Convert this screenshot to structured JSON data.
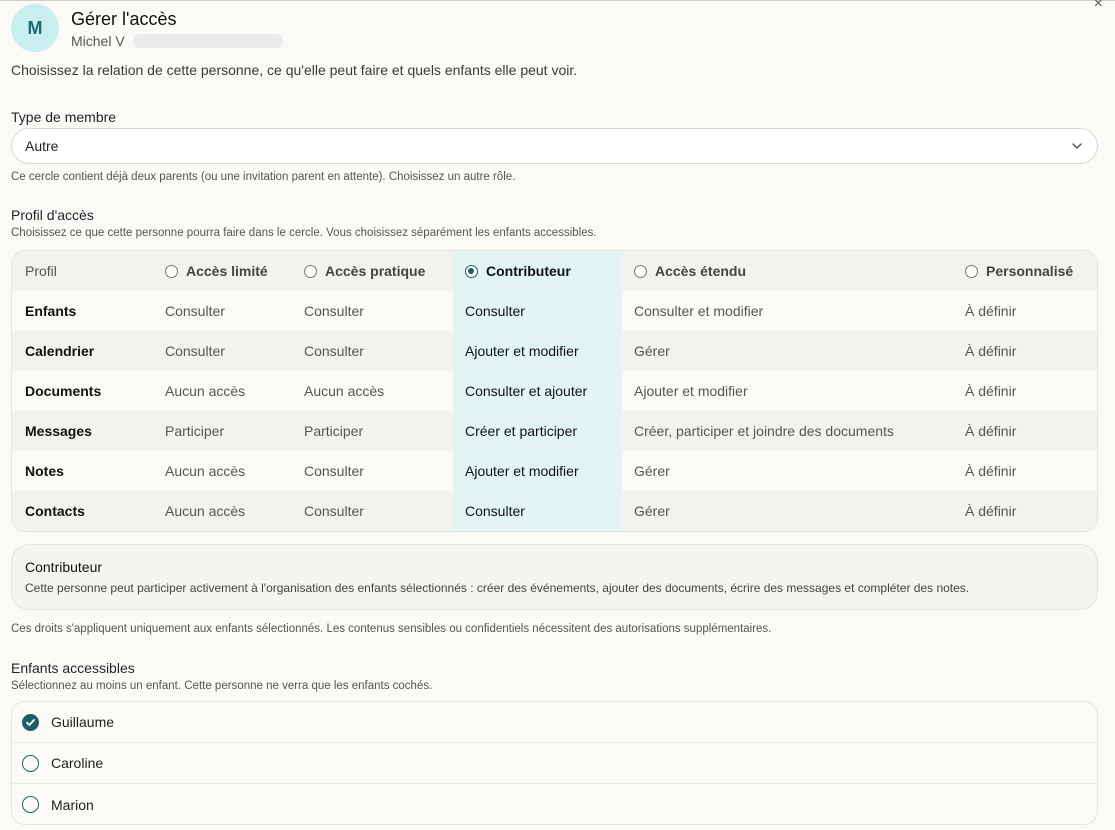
{
  "header": {
    "avatar_initial": "M",
    "title": "Gérer l'accès",
    "user_name": "Michel V",
    "close_glyph": "×"
  },
  "intro": "Choisissez la relation de cette personne, ce qu'elle peut faire et quels enfants elle peut voir.",
  "member_type": {
    "label": "Type de membre",
    "selected": "Autre",
    "hint": "Ce cercle contient déjà deux parents (ou une invitation parent en attente). Choisissez un autre rôle."
  },
  "access_profile": {
    "label": "Profil d'accès",
    "hint": "Choisissez ce que cette personne pourra faire dans le cercle. Vous choisissez séparément les enfants accessibles.",
    "corner_label": "Profil",
    "columns": [
      {
        "label": "Accès limité",
        "selected": false
      },
      {
        "label": "Accès pratique",
        "selected": false
      },
      {
        "label": "Contributeur",
        "selected": true
      },
      {
        "label": "Accès étendu",
        "selected": false
      },
      {
        "label": "Personnalisé",
        "selected": false
      }
    ],
    "rows": [
      {
        "name": "Enfants",
        "values": [
          "Consulter",
          "Consulter",
          "Consulter",
          "Consulter et modifier",
          "À définir"
        ]
      },
      {
        "name": "Calendrier",
        "values": [
          "Consulter",
          "Consulter",
          "Ajouter et modifier",
          "Gérer",
          "À définir"
        ]
      },
      {
        "name": "Documents",
        "values": [
          "Aucun accès",
          "Aucun accès",
          "Consulter et ajouter",
          "Ajouter et modifier",
          "À définir"
        ]
      },
      {
        "name": "Messages",
        "values": [
          "Participer",
          "Participer",
          "Créer et participer",
          "Créer, participer et joindre des documents",
          "À définir"
        ]
      },
      {
        "name": "Notes",
        "values": [
          "Aucun accès",
          "Consulter",
          "Ajouter et modifier",
          "Gérer",
          "À définir"
        ]
      },
      {
        "name": "Contacts",
        "values": [
          "Aucun accès",
          "Consulter",
          "Consulter",
          "Gérer",
          "À définir"
        ]
      }
    ]
  },
  "profile_description": {
    "title": "Contributeur",
    "text": "Cette personne peut participer activement à l'organisation des enfants sélectionnés : créer des événements, ajouter des documents, écrire des messages et compléter des notes."
  },
  "rights_note": "Ces droits s'appliquent uniquement aux enfants sélectionnés. Les contenus sensibles ou confidentiels nécessitent des autorisations supplémentaires.",
  "children": {
    "label": "Enfants accessibles",
    "hint": "Sélectionnez au moins un enfant. Cette personne ne verra que les enfants cochés.",
    "items": [
      {
        "name": "Guillaume",
        "checked": true
      },
      {
        "name": "Caroline",
        "checked": false
      },
      {
        "name": "Marion",
        "checked": false
      }
    ]
  },
  "colors": {
    "accent": "#1d5f66",
    "avatar_bg": "#c9eef0",
    "highlight_column": "#e3f5f3",
    "background": "#fbfaf6"
  }
}
